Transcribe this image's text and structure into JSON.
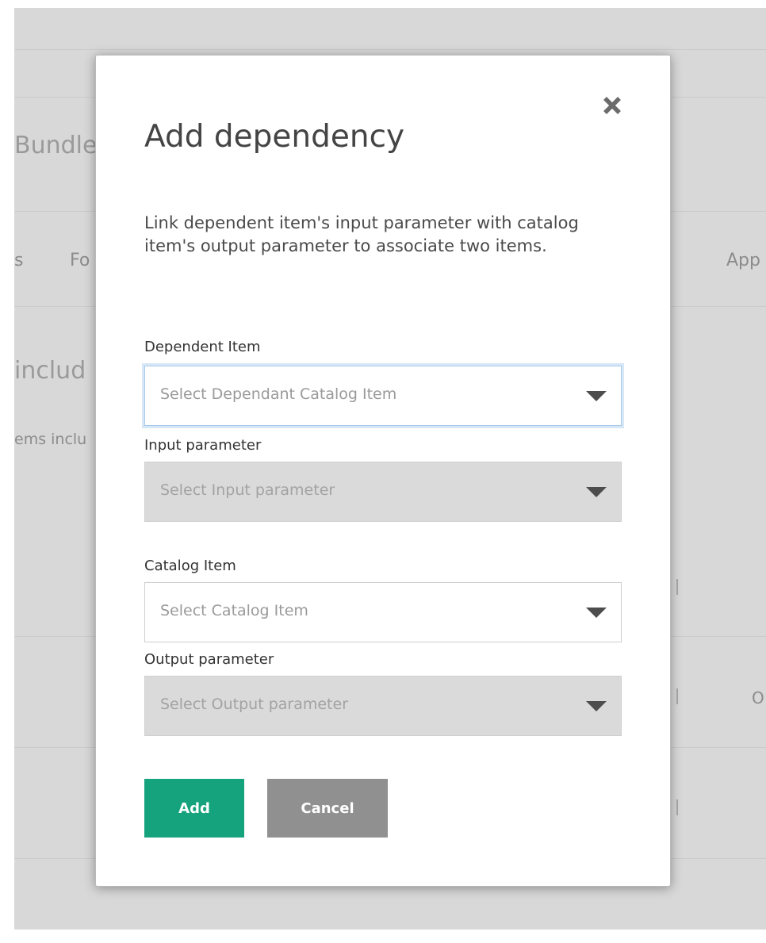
{
  "background": {
    "heading": "Bundle",
    "tabs": [
      "s",
      "Fo",
      "App"
    ],
    "section_heading": "includ",
    "section_subtext": "ems inclu",
    "trailing_text": "O"
  },
  "modal": {
    "title": "Add dependency",
    "close_icon": "close-x-icon",
    "description": "Link dependent item's input parameter with catalog item's output parameter to associate two items.",
    "fields": [
      {
        "label": "Dependent Item",
        "placeholder": "Select Dependant Catalog Item",
        "state": "focused"
      },
      {
        "label": "Input parameter",
        "placeholder": "Select Input parameter",
        "state": "disabled"
      },
      {
        "label": "Catalog Item",
        "placeholder": "Select Catalog Item",
        "state": "enabled"
      },
      {
        "label": "Output parameter",
        "placeholder": "Select Output parameter",
        "state": "disabled"
      }
    ],
    "buttons": {
      "add_label": "Add",
      "cancel_label": "Cancel"
    }
  },
  "colors": {
    "primary": "#15a37e",
    "secondary": "#909090",
    "overlay": "#d8d8d8",
    "focus_ring": "#a9c9e8"
  }
}
